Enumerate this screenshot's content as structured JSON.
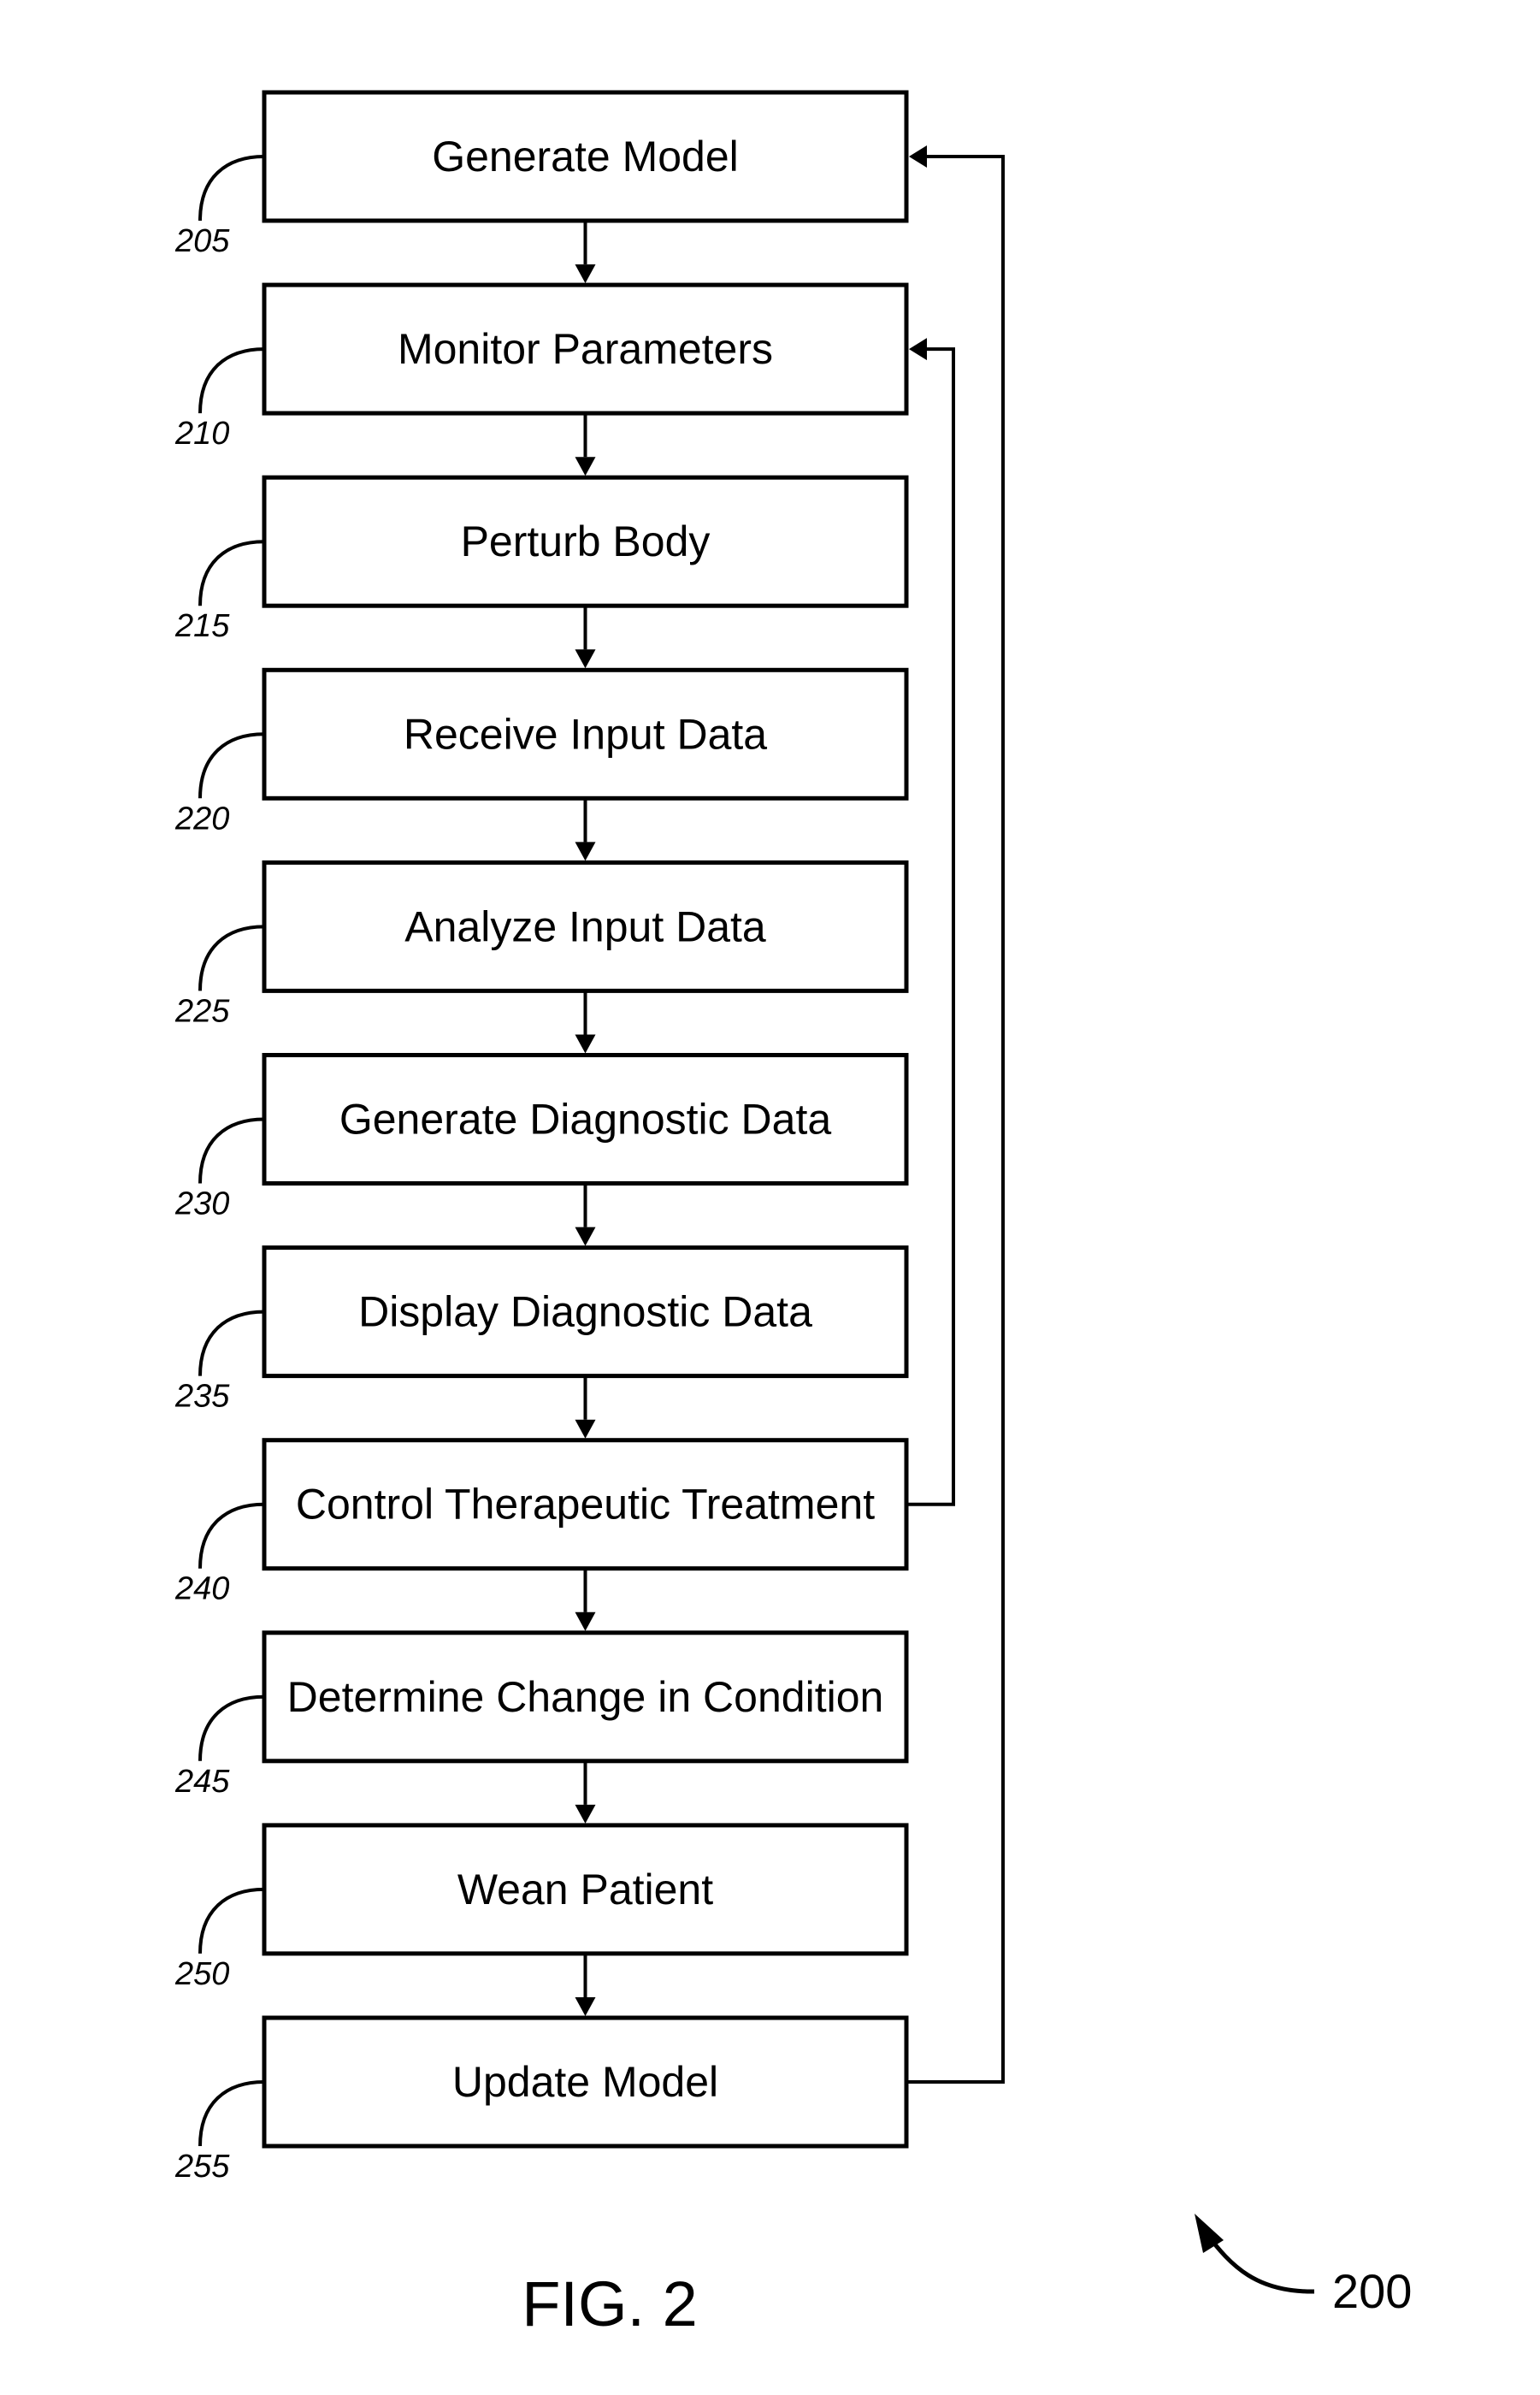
{
  "figure": {
    "title": "FIG. 2",
    "reference_number": "200"
  },
  "steps": [
    {
      "ref": "205",
      "label": "Generate Model"
    },
    {
      "ref": "210",
      "label": "Monitor Parameters"
    },
    {
      "ref": "215",
      "label": "Perturb Body"
    },
    {
      "ref": "220",
      "label": "Receive Input Data"
    },
    {
      "ref": "225",
      "label": "Analyze Input Data"
    },
    {
      "ref": "230",
      "label": "Generate Diagnostic Data"
    },
    {
      "ref": "235",
      "label": "Display Diagnostic Data"
    },
    {
      "ref": "240",
      "label": "Control Therapeutic Treatment"
    },
    {
      "ref": "245",
      "label": "Determine Change in Condition"
    },
    {
      "ref": "250",
      "label": "Wean Patient"
    },
    {
      "ref": "255",
      "label": "Update Model"
    }
  ],
  "feedback_loops": [
    {
      "from": "240",
      "to": "210"
    },
    {
      "from": "255",
      "to": "205"
    }
  ],
  "colors": {
    "stroke": "#000000",
    "background": "#ffffff"
  }
}
